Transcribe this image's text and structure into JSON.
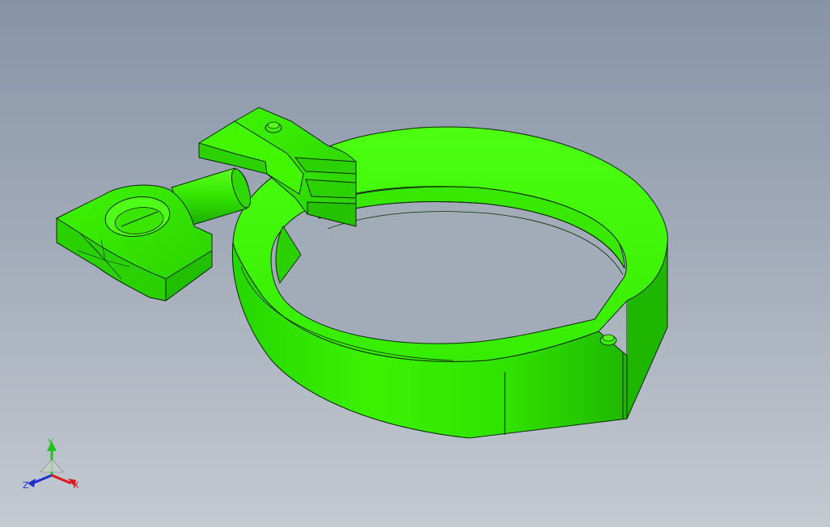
{
  "model": {
    "color": "#33ee00",
    "edge_color": "#0b2a00"
  },
  "background": {
    "top_color": "#8794a6",
    "bottom_color": "#c4cad2"
  },
  "triad": {
    "x_label": "X",
    "y_label": "Y",
    "z_label": "Z",
    "x_color": "#e01818",
    "y_color": "#20c020",
    "z_color": "#2030d0"
  }
}
